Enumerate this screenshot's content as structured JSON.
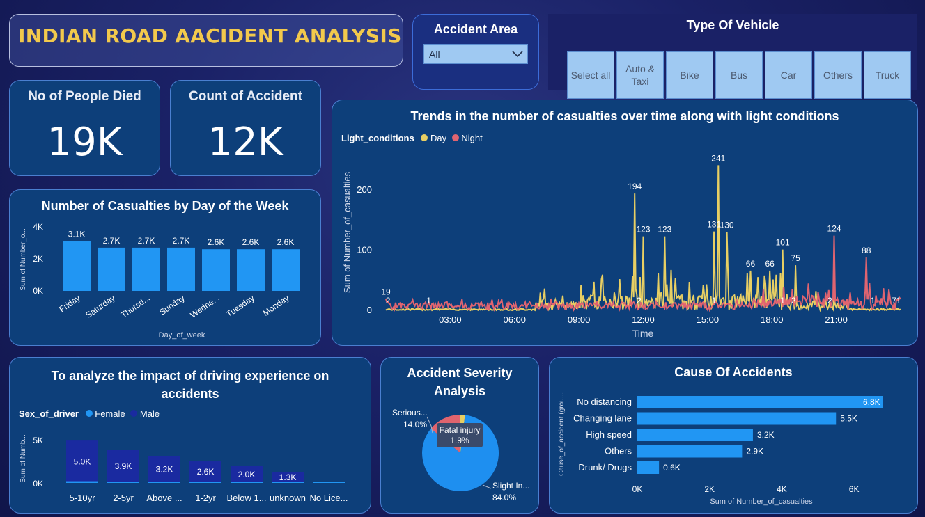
{
  "title": "INDIAN ROAD AACIDENT ANALYSIS",
  "accident_area": {
    "label": "Accident Area",
    "selected": "All"
  },
  "vehicle_type": {
    "label": "Type Of Vehicle",
    "options": [
      "Select all",
      "Auto & Taxi",
      "Bike",
      "Bus",
      "Car",
      "Others",
      "Truck"
    ]
  },
  "kpis": {
    "died_label": "No of People Died",
    "died_value": "19K",
    "count_label": "Count of Accident",
    "count_value": "12K"
  },
  "colors": {
    "accent": "#2196f3",
    "day": "#e8cf63",
    "night": "#e06470",
    "male": "#1a2aa0",
    "female": "#2196f3",
    "gold_title": "#f2c94c"
  },
  "chart_data": [
    {
      "type": "bar",
      "title": "Number of Casualties by Day of the Week",
      "xlabel": "Day_of_week",
      "ylabel": "Sum of Number_o...",
      "categories": [
        "Friday",
        "Saturday",
        "Thursd...",
        "Sunday",
        "Wedne...",
        "Tuesday",
        "Monday"
      ],
      "values": [
        3100,
        2700,
        2700,
        2700,
        2600,
        2600,
        2600
      ],
      "data_labels": [
        "3.1K",
        "2.7K",
        "2.7K",
        "2.7K",
        "2.6K",
        "2.6K",
        "2.6K"
      ],
      "yticks": [
        "0K",
        "2K",
        "4K"
      ],
      "ylim": [
        0,
        4000
      ]
    },
    {
      "type": "line",
      "title": "Trends in the number of casualties over time along with light conditions",
      "xlabel": "Time",
      "ylabel": "Sum of Number_of_casualties",
      "legend_title": "Light_conditions",
      "series": [
        {
          "name": "Day",
          "color": "#e8cf63"
        },
        {
          "name": "Night",
          "color": "#e06470"
        }
      ],
      "xticks": [
        "03:00",
        "06:00",
        "09:00",
        "12:00",
        "15:00",
        "18:00",
        "21:00"
      ],
      "yticks": [
        "0",
        "100",
        "200"
      ],
      "ylim": [
        0,
        260
      ],
      "peaks": [
        {
          "label": "19",
          "hour": 0.0,
          "value": 19,
          "series": "Night"
        },
        {
          "label": "2",
          "hour": 0.1,
          "value": 2,
          "series": "Night"
        },
        {
          "label": "1",
          "hour": 2.0,
          "value": 1,
          "series": "Night"
        },
        {
          "label": "194",
          "hour": 11.6,
          "value": 194,
          "series": "Day"
        },
        {
          "label": "123",
          "hour": 12.0,
          "value": 123,
          "series": "Day"
        },
        {
          "label": "2",
          "hour": 11.8,
          "value": 2,
          "series": "Night"
        },
        {
          "label": "123",
          "hour": 13.0,
          "value": 123,
          "series": "Day"
        },
        {
          "label": "241",
          "hour": 15.5,
          "value": 241,
          "series": "Day"
        },
        {
          "label": "131",
          "hour": 15.3,
          "value": 131,
          "series": "Day"
        },
        {
          "label": "130",
          "hour": 15.9,
          "value": 130,
          "series": "Day"
        },
        {
          "label": "1",
          "hour": 15.3,
          "value": 1,
          "series": "Night"
        },
        {
          "label": "66",
          "hour": 17.0,
          "value": 66,
          "series": "Day"
        },
        {
          "label": "66",
          "hour": 17.9,
          "value": 66,
          "series": "Day"
        },
        {
          "label": "101",
          "hour": 18.5,
          "value": 101,
          "series": "Day"
        },
        {
          "label": "75",
          "hour": 19.1,
          "value": 75,
          "series": "Day"
        },
        {
          "label": "1",
          "hour": 18.5,
          "value": 1,
          "series": "Night"
        },
        {
          "label": "2",
          "hour": 19.0,
          "value": 2,
          "series": "Night"
        },
        {
          "label": "124",
          "hour": 20.9,
          "value": 124,
          "series": "Night"
        },
        {
          "label": "2",
          "hour": 20.7,
          "value": 2,
          "series": "Night"
        },
        {
          "label": "88",
          "hour": 22.4,
          "value": 88,
          "series": "Night"
        },
        {
          "label": "1",
          "hour": 22.7,
          "value": 1,
          "series": "Night"
        },
        {
          "label": "7",
          "hour": 23.7,
          "value": 7,
          "series": "Night"
        },
        {
          "label": "1",
          "hour": 23.9,
          "value": 1,
          "series": "Night"
        }
      ]
    },
    {
      "type": "bar",
      "title": "To analyze the impact of driving experience on accidents",
      "ylabel": "Sum of Numb...",
      "legend_title": "Sex_of_driver",
      "series": [
        {
          "name": "Female",
          "color": "#2196f3",
          "values": [
            200,
            150,
            140,
            110,
            90,
            60,
            20
          ]
        },
        {
          "name": "Male",
          "color": "#1a2aa0",
          "values": [
            5000,
            3900,
            3200,
            2600,
            2000,
            1300,
            100
          ]
        }
      ],
      "categories": [
        "5-10yr",
        "2-5yr",
        "Above ...",
        "1-2yr",
        "Below 1...",
        "unknown",
        "No Lice..."
      ],
      "data_labels": [
        "5.0K",
        "3.9K",
        "3.2K",
        "2.6K",
        "2.0K",
        "1.3K",
        ""
      ],
      "yticks": [
        "0K",
        "5K"
      ],
      "ylim": [
        0,
        5500
      ]
    },
    {
      "type": "pie",
      "title": "Accident Severity Analysis",
      "slices": [
        {
          "name": "Slight In...",
          "value": 84.0,
          "label": "84.0%",
          "color": "#1e8ff0"
        },
        {
          "name": "Serious...",
          "value": 14.0,
          "label": "14.0%",
          "color": "#e0646e"
        },
        {
          "name": "Fatal injury",
          "value": 1.9,
          "label": "1.9%",
          "color": "#e8cf63"
        }
      ]
    },
    {
      "type": "bar",
      "orientation": "horizontal",
      "title": "Cause Of Accidents",
      "xlabel": "Sum of Number_of_casualties",
      "ylabel": "Cause_of_accident (grou...",
      "categories": [
        "No distancing",
        "Changing lane",
        "High speed",
        "Others",
        "Drunk/ Drugs"
      ],
      "values": [
        6800,
        5500,
        3200,
        2900,
        600
      ],
      "data_labels": [
        "6.8K",
        "5.5K",
        "3.2K",
        "2.9K",
        "0.6K"
      ],
      "xticks": [
        "0K",
        "2K",
        "4K",
        "6K"
      ],
      "xlim": [
        0,
        7000
      ]
    }
  ]
}
